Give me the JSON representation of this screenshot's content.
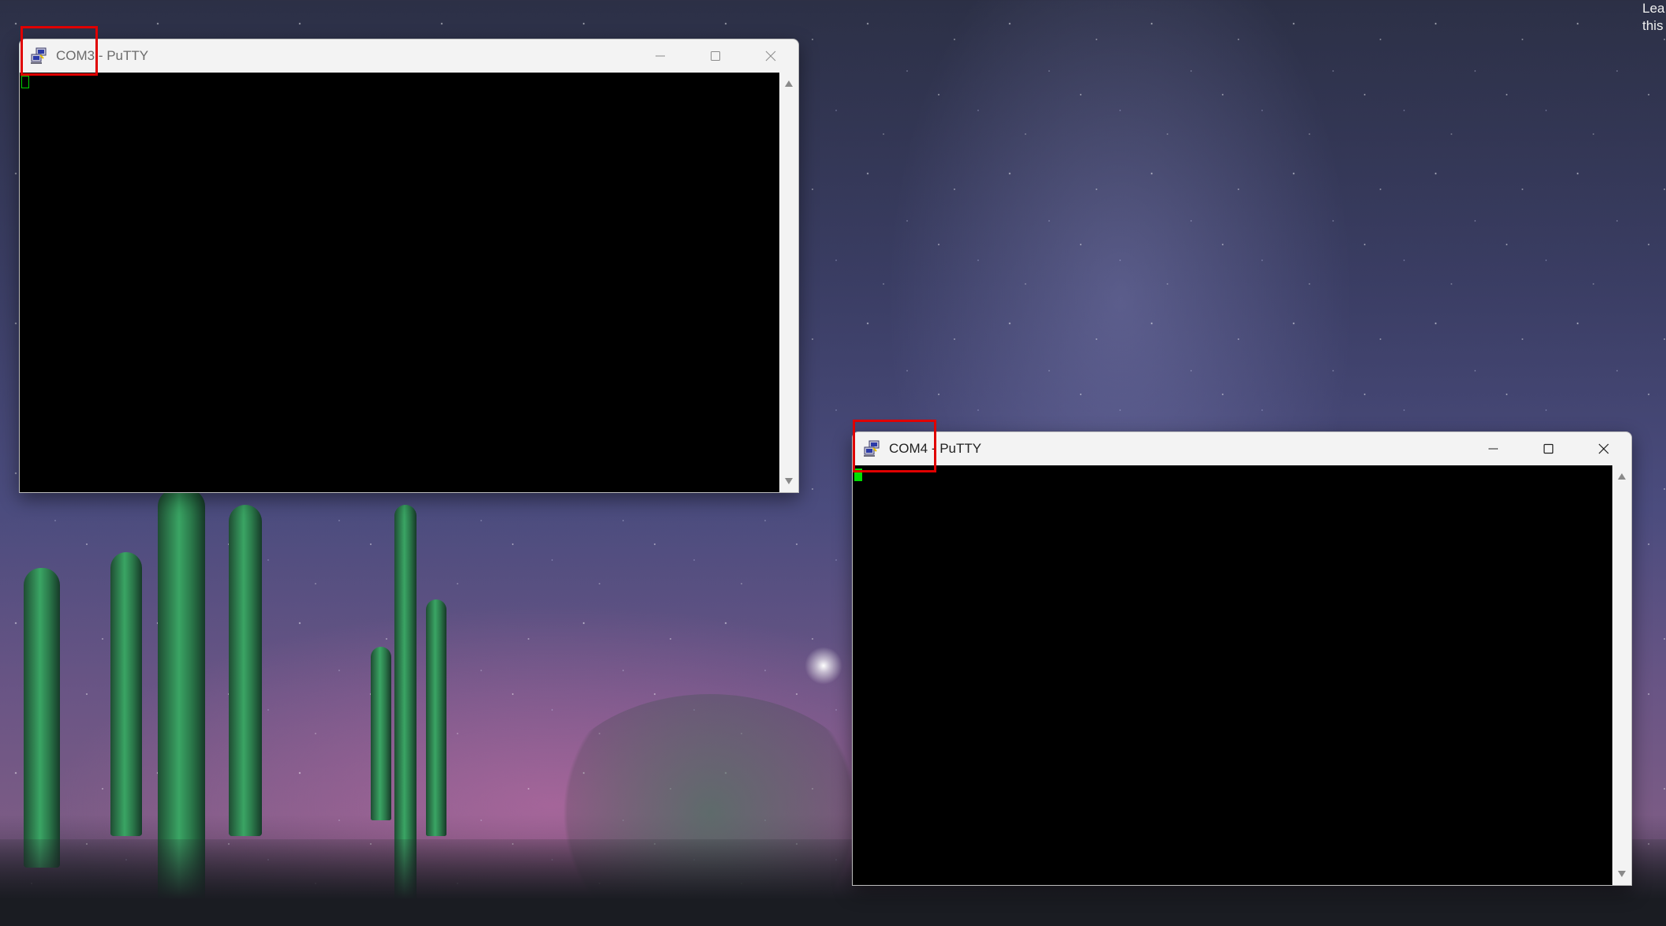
{
  "desktop": {
    "corner_text_line1": "Lea",
    "corner_text_line2": "this"
  },
  "windows": [
    {
      "title": "COM3 - PuTTY",
      "state": "inactive",
      "minimize_label": "Minimize",
      "maximize_label": "Maximize",
      "close_label": "Close",
      "cursor_style": "hollow"
    },
    {
      "title": "COM4 - PuTTY",
      "state": "active",
      "minimize_label": "Minimize",
      "maximize_label": "Maximize",
      "close_label": "Close",
      "cursor_style": "solid"
    }
  ],
  "colors": {
    "terminal_background": "#000000",
    "cursor": "#00e000",
    "highlight_box": "#e00000"
  },
  "icons": {
    "app": "putty-icon",
    "minimize": "minimize-icon",
    "maximize": "maximize-icon",
    "close": "close-icon",
    "scroll_up": "scroll-up-arrow-icon",
    "scroll_down": "scroll-down-arrow-icon"
  }
}
